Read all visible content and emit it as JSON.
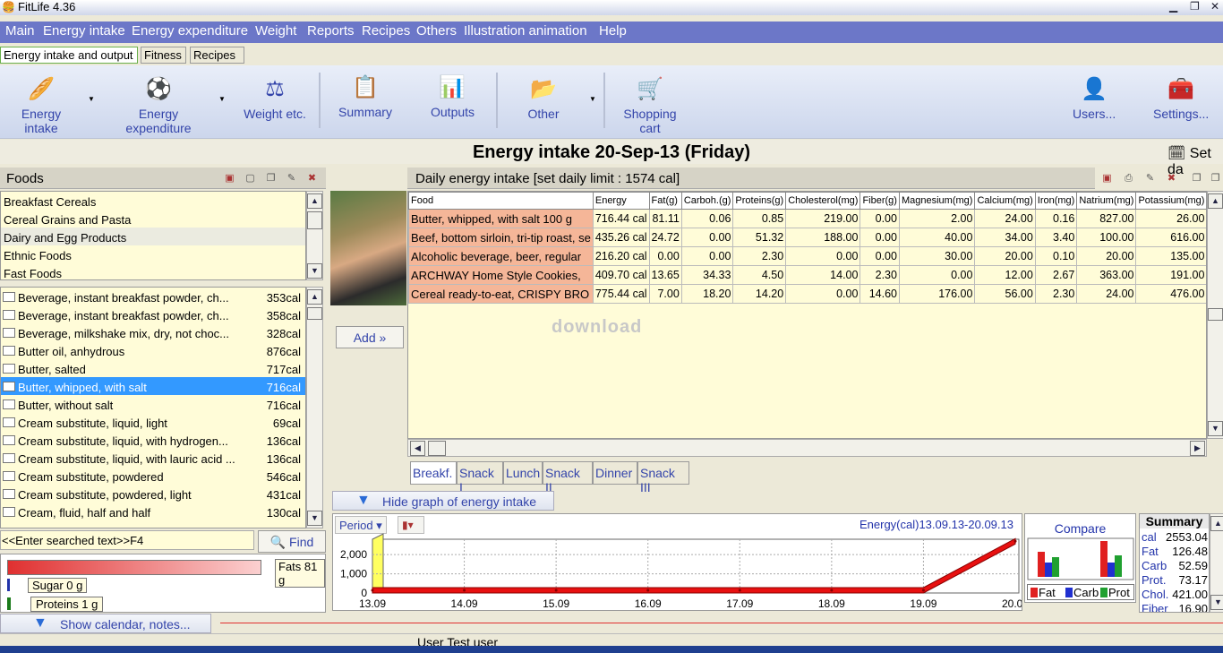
{
  "app": {
    "title": "FitLife 4.36"
  },
  "menu": [
    "Main",
    "Energy intake",
    "Energy expenditure",
    "Weight",
    "Reports",
    "Recipes",
    "Others",
    "Illustration animation",
    "Help"
  ],
  "top_tabs": [
    "Energy intake and output",
    "Fitness",
    "Recipes"
  ],
  "toolbar": {
    "energy_intake": "Energy intake",
    "energy_expenditure": "Energy expenditure",
    "weight": "Weight etc.",
    "summary": "Summary",
    "outputs": "Outputs",
    "other": "Other",
    "shopping_cart": "Shopping cart",
    "users": "Users...",
    "settings": "Settings..."
  },
  "heading": {
    "title": "Energy intake 20-Sep-13 (Friday)",
    "set_date": "Set da"
  },
  "foods": {
    "header": "Foods",
    "categories": [
      "Breakfast Cereals",
      "Cereal Grains and Pasta",
      "Dairy and Egg Products",
      "Ethnic Foods",
      "Fast Foods"
    ],
    "items": [
      {
        "name": "Beverage, instant breakfast powder, ch...",
        "cal": "353cal"
      },
      {
        "name": "Beverage, instant breakfast powder, ch...",
        "cal": "358cal"
      },
      {
        "name": "Beverage, milkshake mix, dry, not choc...",
        "cal": "328cal"
      },
      {
        "name": "Butter oil, anhydrous",
        "cal": "876cal"
      },
      {
        "name": "Butter, salted",
        "cal": "717cal"
      },
      {
        "name": "Butter, whipped, with salt",
        "cal": "716cal"
      },
      {
        "name": "Butter, without salt",
        "cal": "716cal"
      },
      {
        "name": "Cream substitute, liquid, light",
        "cal": "69cal"
      },
      {
        "name": "Cream substitute, liquid, with hydrogen...",
        "cal": "136cal"
      },
      {
        "name": "Cream substitute, liquid, with lauric acid ...",
        "cal": "136cal"
      },
      {
        "name": "Cream substitute, powdered",
        "cal": "546cal"
      },
      {
        "name": "Cream substitute, powdered, light",
        "cal": "431cal"
      },
      {
        "name": "Cream, fluid, half and half",
        "cal": "130cal"
      }
    ],
    "search_text": "<<Enter searched text>>F4",
    "find": "Find"
  },
  "nutrients_panel": {
    "fats": "Fats 81 g",
    "sugar": "Sugar 0 g",
    "proteins": "Proteins 1 g",
    "fats_fraction": 0.81
  },
  "add_button": "Add »",
  "daily": {
    "header": "Daily energy intake [set daily limit : 1574 cal]",
    "columns": [
      "Food",
      "Energy",
      "Fat(g)",
      "Carboh.(g)",
      "Proteins(g)",
      "Cholesterol(mg)",
      "Fiber(g)",
      "Magnesium(mg)",
      "Calcium(mg)",
      "Iron(mg)",
      "Natrium(mg)",
      "Potassium(mg)",
      "Vi"
    ],
    "rows": [
      [
        "Butter, whipped, with salt 100 g",
        "716.44 cal",
        "81.11",
        "0.06",
        "0.85",
        "219.00",
        "0.00",
        "2.00",
        "24.00",
        "0.16",
        "827.00",
        "26.00"
      ],
      [
        "Beef, bottom sirloin, tri-tip roast, se",
        "435.26 cal",
        "24.72",
        "0.00",
        "51.32",
        "188.00",
        "0.00",
        "40.00",
        "34.00",
        "3.40",
        "100.00",
        "616.00"
      ],
      [
        "Alcoholic beverage, beer, regular",
        "216.20 cal",
        "0.00",
        "0.00",
        "2.30",
        "0.00",
        "0.00",
        "30.00",
        "20.00",
        "0.10",
        "20.00",
        "135.00"
      ],
      [
        "ARCHWAY Home Style Cookies,",
        "409.70 cal",
        "13.65",
        "34.33",
        "4.50",
        "14.00",
        "2.30",
        "0.00",
        "12.00",
        "2.67",
        "363.00",
        "191.00"
      ],
      [
        "Cereal ready-to-eat, CRISPY BRO",
        "775.44 cal",
        "7.00",
        "18.20",
        "14.20",
        "0.00",
        "14.60",
        "176.00",
        "56.00",
        "2.30",
        "24.00",
        "476.00"
      ]
    ]
  },
  "meal_tabs": [
    "Breakf.",
    "Snack I",
    "Lunch",
    "Snack II",
    "Dinner",
    "Snack III"
  ],
  "hide_graph": "Hide graph of energy intake",
  "graph_controls": {
    "period": "Period",
    "chart_type_icon": "bar-chart-icon"
  },
  "chart_data": {
    "type": "area",
    "title": "Energy(cal)13.09.13-20.09.13",
    "x": [
      "13.09",
      "14.09",
      "15.09",
      "16.09",
      "17.09",
      "18.09",
      "19.09",
      "20.09"
    ],
    "values": [
      0,
      0,
      0,
      0,
      0,
      0,
      0,
      2553.04
    ],
    "yticks": [
      "0",
      "1,000",
      "2,000"
    ],
    "ylim": [
      0,
      2800
    ]
  },
  "compare": {
    "title": "Compare",
    "legend": [
      "Fat",
      "Carb",
      "Prot"
    ],
    "colors": {
      "fat": "#e02020",
      "carb": "#2030d0",
      "prot": "#20a030"
    }
  },
  "summary": {
    "title": "Summary",
    "rows": [
      {
        "k": "cal",
        "v": "2553.04"
      },
      {
        "k": "Fat",
        "v": "126.48"
      },
      {
        "k": "Carb",
        "v": "52.59"
      },
      {
        "k": "Prot.",
        "v": "73.17"
      },
      {
        "k": "Chol.",
        "v": "421.00"
      },
      {
        "k": "Fiber",
        "v": "16.90"
      }
    ]
  },
  "show_calendar": "Show calendar, notes...",
  "status": {
    "user": "User Test user"
  },
  "watermark": "download"
}
